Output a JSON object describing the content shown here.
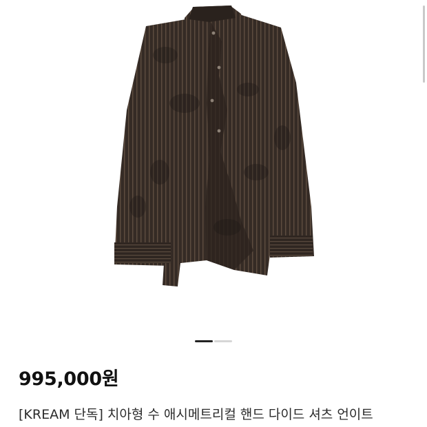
{
  "product": {
    "image_alt": "Asymmetrical hand-dyed striped shirt, dark brown",
    "shirt_color": "#3a302a",
    "stripe_color": "#5a4a3e",
    "carousel": {
      "total_slides": 2,
      "active_slide": 1
    },
    "price": "995,000원",
    "title": "[KREAM 단독] 치아형 수 애시메트리컬 핸드 다이드 셔츠 언이트"
  }
}
